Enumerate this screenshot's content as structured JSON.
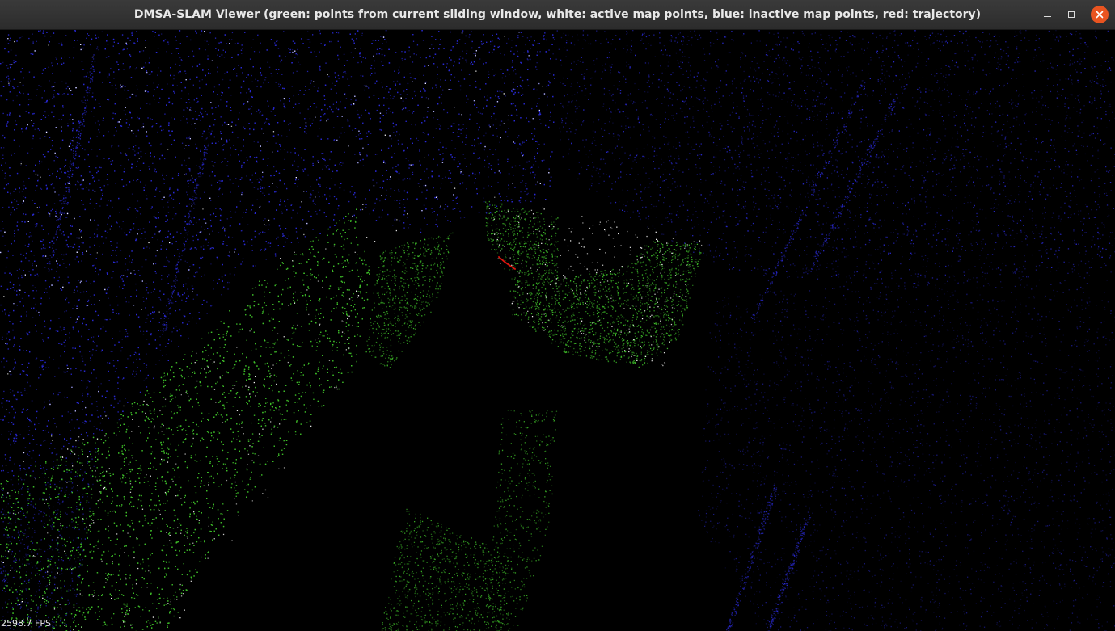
{
  "window": {
    "title": "DMSA-SLAM Viewer (green: points from current sliding window, white: active map points, blue: inactive map points, red: trajectory)",
    "controls": {
      "minimize": "minimize-icon",
      "maximize": "maximize-icon",
      "close": "close-icon"
    }
  },
  "viewer": {
    "background": "#000000",
    "point_colors": {
      "sliding_window": "#3fbf2a",
      "active_map": "#ffffff",
      "inactive_map": "#2a2ad6",
      "trajectory": "#e0140e"
    },
    "fps_label": "2598.7 FPS"
  },
  "colors": {
    "titlebar": "#333333",
    "close_button": "#e95420"
  }
}
